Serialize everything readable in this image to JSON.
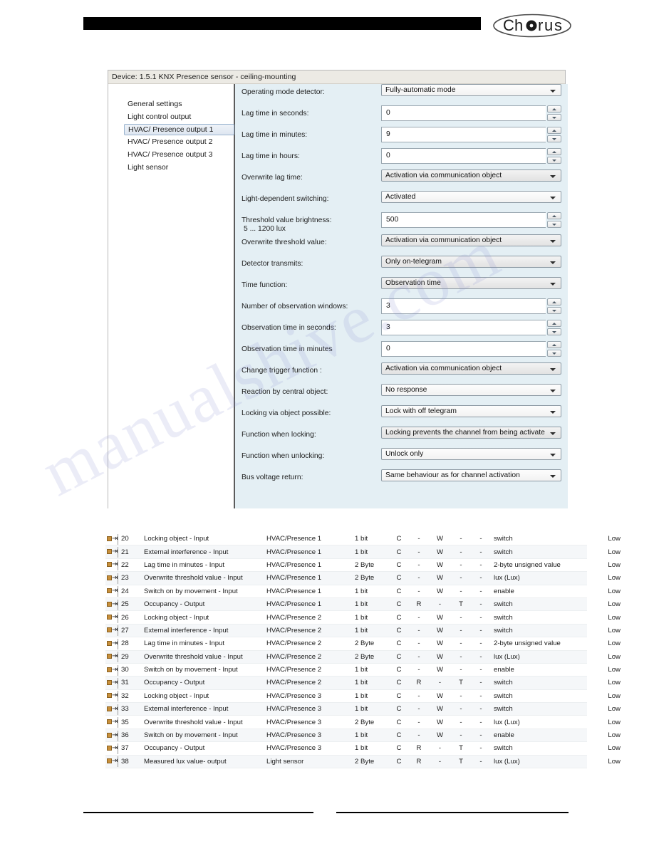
{
  "header": {
    "logo_text": "Chorus"
  },
  "dialog": {
    "title": "Device: 1.5.1  KNX Presence sensor - ceiling-mounting",
    "tree": [
      {
        "label": "General settings",
        "selected": false
      },
      {
        "label": "Light control output",
        "selected": false
      },
      {
        "label": "HVAC/ Presence output 1",
        "selected": true
      },
      {
        "label": "HVAC/ Presence output 2",
        "selected": false
      },
      {
        "label": "HVAC/ Presence output 3",
        "selected": false
      },
      {
        "label": "Light sensor",
        "selected": false
      }
    ],
    "fields": [
      {
        "label": "Operating mode detector:",
        "sub": "",
        "kind": "combo",
        "style": "plain",
        "value": "Fully-automatic mode"
      },
      {
        "label": "Lag time in seconds:",
        "sub": "",
        "kind": "spin",
        "value": "0"
      },
      {
        "label": "Lag time in minutes:",
        "sub": "",
        "kind": "spin",
        "value": "9"
      },
      {
        "label": "Lag time in hours:",
        "sub": "",
        "kind": "spin",
        "value": "0"
      },
      {
        "label": "Overwrite lag time:",
        "sub": "",
        "kind": "combo",
        "style": "shaded",
        "value": "Activation via communication object"
      },
      {
        "label": "Light-dependent switching:",
        "sub": "",
        "kind": "combo",
        "style": "plain",
        "value": "Activated"
      },
      {
        "label": "Threshold value brightness:",
        "sub": " 5 ... 1200 lux",
        "kind": "spin",
        "value": "500"
      },
      {
        "label": "Overwrite threshold value:",
        "sub": "",
        "kind": "combo",
        "style": "shaded",
        "value": "Activation via communication object"
      },
      {
        "label": "Detector transmits:",
        "sub": "",
        "kind": "combo",
        "style": "shaded",
        "value": "Only on-telegram"
      },
      {
        "label": "Time function:",
        "sub": "",
        "kind": "combo",
        "style": "shaded",
        "value": "Observation time"
      },
      {
        "label": "Number of observation windows:",
        "sub": "",
        "kind": "spin",
        "value": "3"
      },
      {
        "label": "Observation time in seconds:",
        "sub": "",
        "kind": "spin",
        "value": "3"
      },
      {
        "label": "Observation time in minutes",
        "sub": "",
        "kind": "spin",
        "value": "0"
      },
      {
        "label": "Change trigger function :",
        "sub": "",
        "kind": "combo",
        "style": "shaded",
        "value": "Activation via communication object"
      },
      {
        "label": "Reaction by central object:",
        "sub": "",
        "kind": "combo",
        "style": "plain",
        "value": "No response"
      },
      {
        "label": "Locking via object possible:",
        "sub": "",
        "kind": "combo",
        "style": "plain",
        "value": "Lock with off telegram"
      },
      {
        "label": "Function when locking:",
        "sub": "",
        "kind": "combo",
        "style": "shaded",
        "value": "Locking prevents the channel from being activate"
      },
      {
        "label": "Function when unlocking:",
        "sub": "",
        "kind": "combo",
        "style": "plain",
        "value": "Unlock only"
      },
      {
        "label": "Bus voltage return:",
        "sub": "",
        "kind": "combo",
        "style": "plain",
        "value": "Same behaviour as for channel activation"
      }
    ]
  },
  "object_table": {
    "icon_name": "communication-object-icon",
    "rows": [
      {
        "num": "20",
        "name": "Locking object - Input",
        "function": "HVAC/Presence 1",
        "length": "1 bit",
        "c": "C",
        "r": "-",
        "w": "W",
        "t": "-",
        "u": "-",
        "type": "switch",
        "priority": "Low"
      },
      {
        "num": "21",
        "name": "External interference - Input",
        "function": "HVAC/Presence 1",
        "length": "1 bit",
        "c": "C",
        "r": "-",
        "w": "W",
        "t": "-",
        "u": "-",
        "type": "switch",
        "priority": "Low"
      },
      {
        "num": "22",
        "name": "Lag time in minutes - Input",
        "function": "HVAC/Presence 1",
        "length": "2 Byte",
        "c": "C",
        "r": "-",
        "w": "W",
        "t": "-",
        "u": "-",
        "type": "2-byte unsigned value",
        "priority": "Low"
      },
      {
        "num": "23",
        "name": "Overwrite threshold value - Input",
        "function": "HVAC/Presence 1",
        "length": "2 Byte",
        "c": "C",
        "r": "-",
        "w": "W",
        "t": "-",
        "u": "-",
        "type": "lux (Lux)",
        "priority": "Low"
      },
      {
        "num": "24",
        "name": "Switch on by movement - Input",
        "function": "HVAC/Presence 1",
        "length": "1 bit",
        "c": "C",
        "r": "-",
        "w": "W",
        "t": "-",
        "u": "-",
        "type": "enable",
        "priority": "Low"
      },
      {
        "num": "25",
        "name": "Occupancy - Output",
        "function": "HVAC/Presence 1",
        "length": "1 bit",
        "c": "C",
        "r": "R",
        "w": "-",
        "t": "T",
        "u": "-",
        "type": "switch",
        "priority": "Low"
      },
      {
        "num": "26",
        "name": "Locking object - Input",
        "function": "HVAC/Presence 2",
        "length": "1 bit",
        "c": "C",
        "r": "-",
        "w": "W",
        "t": "-",
        "u": "-",
        "type": "switch",
        "priority": "Low"
      },
      {
        "num": "27",
        "name": "External interference - Input",
        "function": "HVAC/Presence 2",
        "length": "1 bit",
        "c": "C",
        "r": "-",
        "w": "W",
        "t": "-",
        "u": "-",
        "type": "switch",
        "priority": "Low"
      },
      {
        "num": "28",
        "name": "Lag time in minutes - Input",
        "function": "HVAC/Presence 2",
        "length": "2 Byte",
        "c": "C",
        "r": "-",
        "w": "W",
        "t": "-",
        "u": "-",
        "type": "2-byte unsigned value",
        "priority": "Low"
      },
      {
        "num": "29",
        "name": "Overwrite threshold value - Input",
        "function": "HVAC/Presence 2",
        "length": "2 Byte",
        "c": "C",
        "r": "-",
        "w": "W",
        "t": "-",
        "u": "-",
        "type": "lux (Lux)",
        "priority": "Low"
      },
      {
        "num": "30",
        "name": "Switch on by movement - Input",
        "function": "HVAC/Presence 2",
        "length": "1 bit",
        "c": "C",
        "r": "-",
        "w": "W",
        "t": "-",
        "u": "-",
        "type": "enable",
        "priority": "Low"
      },
      {
        "num": "31",
        "name": "Occupancy - Output",
        "function": "HVAC/Presence 2",
        "length": "1 bit",
        "c": "C",
        "r": "R",
        "w": "-",
        "t": "T",
        "u": "-",
        "type": "switch",
        "priority": "Low"
      },
      {
        "num": "32",
        "name": "Locking object - Input",
        "function": "HVAC/Presence 3",
        "length": "1 bit",
        "c": "C",
        "r": "-",
        "w": "W",
        "t": "-",
        "u": "-",
        "type": "switch",
        "priority": "Low"
      },
      {
        "num": "33",
        "name": "External interference - Input",
        "function": "HVAC/Presence 3",
        "length": "1 bit",
        "c": "C",
        "r": "-",
        "w": "W",
        "t": "-",
        "u": "-",
        "type": "switch",
        "priority": "Low"
      },
      {
        "num": "35",
        "name": "Overwrite threshold value - Input",
        "function": "HVAC/Presence 3",
        "length": "2 Byte",
        "c": "C",
        "r": "-",
        "w": "W",
        "t": "-",
        "u": "-",
        "type": "lux (Lux)",
        "priority": "Low"
      },
      {
        "num": "36",
        "name": "Switch on by movement - Input",
        "function": "HVAC/Presence 3",
        "length": "1 bit",
        "c": "C",
        "r": "-",
        "w": "W",
        "t": "-",
        "u": "-",
        "type": "enable",
        "priority": "Low"
      },
      {
        "num": "37",
        "name": "Occupancy - Output",
        "function": "HVAC/Presence 3",
        "length": "1 bit",
        "c": "C",
        "r": "R",
        "w": "-",
        "t": "T",
        "u": "-",
        "type": "switch",
        "priority": "Low"
      },
      {
        "num": "38",
        "name": "Measured lux value- output",
        "function": "Light sensor",
        "length": "2 Byte",
        "c": "C",
        "r": "R",
        "w": "-",
        "t": "T",
        "u": "-",
        "type": "lux (Lux)",
        "priority": "Low"
      }
    ]
  },
  "watermark": {
    "text": "manualshive.com"
  },
  "colors": {
    "accent_black": "#000000",
    "panel_blue": "#e4eff4",
    "icon_orange": "#c8903c"
  }
}
